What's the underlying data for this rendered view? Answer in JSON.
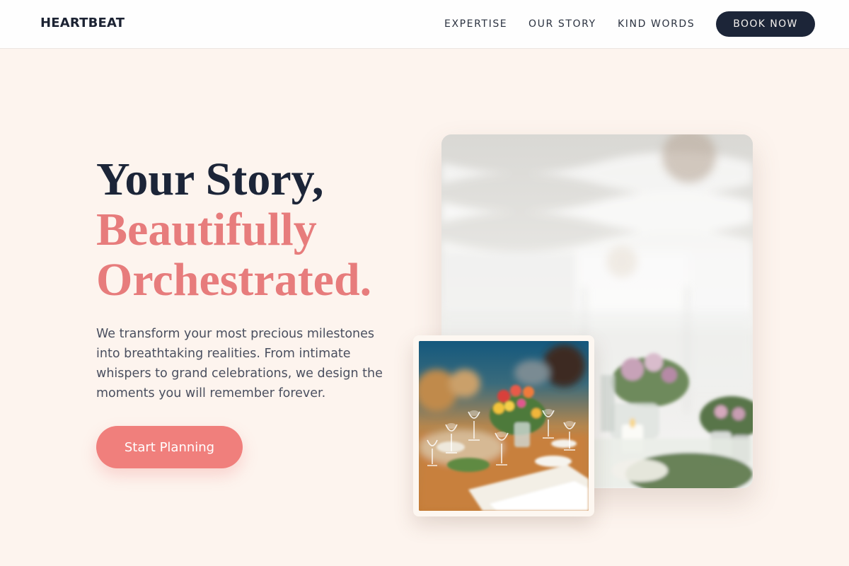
{
  "brand": {
    "name": "HEARTBEAT"
  },
  "nav": {
    "items": [
      {
        "label": "EXPERTISE"
      },
      {
        "label": "OUR STORY"
      },
      {
        "label": "KIND WORDS"
      }
    ],
    "cta_label": "BOOK NOW"
  },
  "hero": {
    "title_line1": "Your Story,",
    "title_line2": "Beautifully",
    "title_line3": "Orchestrated.",
    "description": "We transform your most precious milestones into breathtaking realities. From intimate whispers to grand celebrations, we design the moments you will remember forever.",
    "cta_label": "Start Planning"
  },
  "colors": {
    "page_background": "#fdf4ee",
    "navy": "#1c2538",
    "accent_pink": "#e77c7c",
    "button_pink": "#f07f7c"
  }
}
